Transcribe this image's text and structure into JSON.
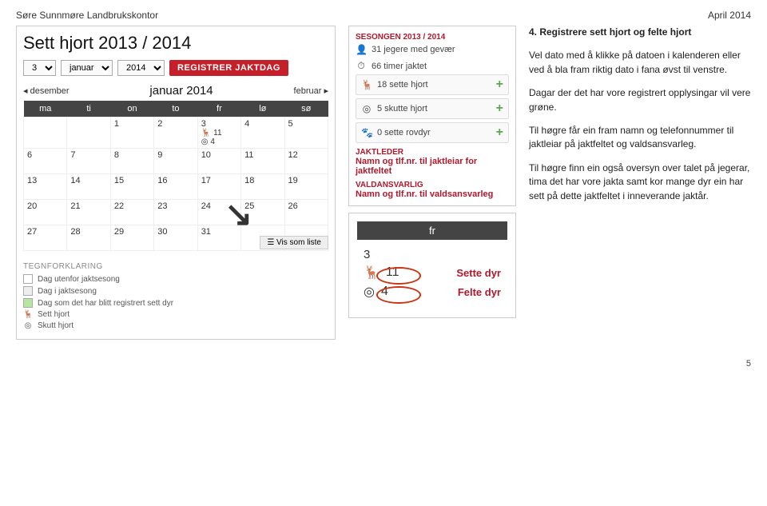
{
  "doc": {
    "org": "Søre Sunnmøre Landbrukskontor",
    "date": "April 2014",
    "pagenum": "5"
  },
  "app": {
    "title": "Sett hjort 2013 / 2014",
    "day_sel": "3",
    "month_sel": "januar",
    "year_sel": "2014",
    "register_btn": "REGISTRER JAKTDAG",
    "prev_month": "◂ desember",
    "cur_month": "januar 2014",
    "next_month": "februar ▸",
    "weekdays": [
      "ma",
      "ti",
      "on",
      "to",
      "fr",
      "lø",
      "sø"
    ],
    "liste_btn": "☰ Vis som liste",
    "day3_deer": "11",
    "day3_target": "4"
  },
  "legend": {
    "title": "TEGNFORKLARING",
    "outside": "Dag utenfor jaktsesong",
    "inside": "Dag i jaktsesong",
    "registered": "Dag som det har blitt registrert sett dyr",
    "sett": "Sett hjort",
    "skutt": "Skutt hjort"
  },
  "stats": {
    "season_label": "SESONGEN 2013 / 2014",
    "hunters": "31 jegere med gevær",
    "hours": "66 timer jaktet",
    "sette": "18 sette hjort",
    "skutte": "5 skutte hjort",
    "rovdyr": "0 sette rovdyr",
    "jaktleder_label": "JAKTLEDER",
    "jaktleder_text": "Namn og tlf.nr. til jaktleiar for jaktfeltet",
    "vald_label": "VALDANSVARLIG",
    "vald_text": "Namn og tlf.nr. til valdsansvarleg"
  },
  "detail": {
    "fr": "fr",
    "num": "3",
    "deer_val": "11",
    "target_val": "4",
    "sette_label": "Sette dyr",
    "felte_label": "Felte dyr"
  },
  "text": {
    "heading": "4. Registrere sett hjort og felte hjort",
    "p1": "Vel dato med å klikke på datoen i kalenderen eller ved å bla fram riktig dato i fana øvst til venstre.",
    "p2": "Dagar der det har vore registrert opplysingar vil vere grøne.",
    "p3": "Til høgre får ein fram namn og telefonnummer til jaktleiar på jaktfeltet og valdsansvarleg.",
    "p4": "Til høgre finn ein også oversyn over talet på jegerar, tima det har vore jakta samt kor mange dyr ein har sett på dette jaktfeltet i inneverande jaktår."
  }
}
